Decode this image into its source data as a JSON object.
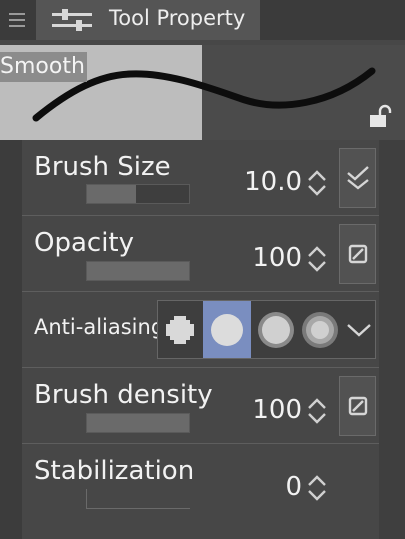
{
  "window": {
    "tab_title": "Tool Property",
    "menu_icon": "hamburger-menu-icon",
    "tab_icon": "sliders-icon"
  },
  "preview": {
    "preset_name": "Smooth",
    "lock_icon": "unlocked-padlock-icon"
  },
  "properties": [
    {
      "label": "Brush Size",
      "value": "10.0",
      "slider_fill": 0.48,
      "side_icon": "check-chevron-icon"
    },
    {
      "label": "Opacity",
      "value": "100",
      "slider_fill": 1.0,
      "side_icon": "dynamics-icon"
    },
    {
      "label": "Anti-aliasing",
      "options": [
        "none",
        "weak",
        "medium",
        "strong"
      ],
      "selected_option": "weak"
    },
    {
      "label": "Brush density",
      "value": "100",
      "slider_fill": 1.0,
      "side_icon": "dynamics-icon"
    },
    {
      "label": "Stabilization",
      "value": "0",
      "slider_fill": 0.0
    }
  ],
  "colors": {
    "selected_accent": "#7a8ec0",
    "panel_bg": "#474747"
  }
}
